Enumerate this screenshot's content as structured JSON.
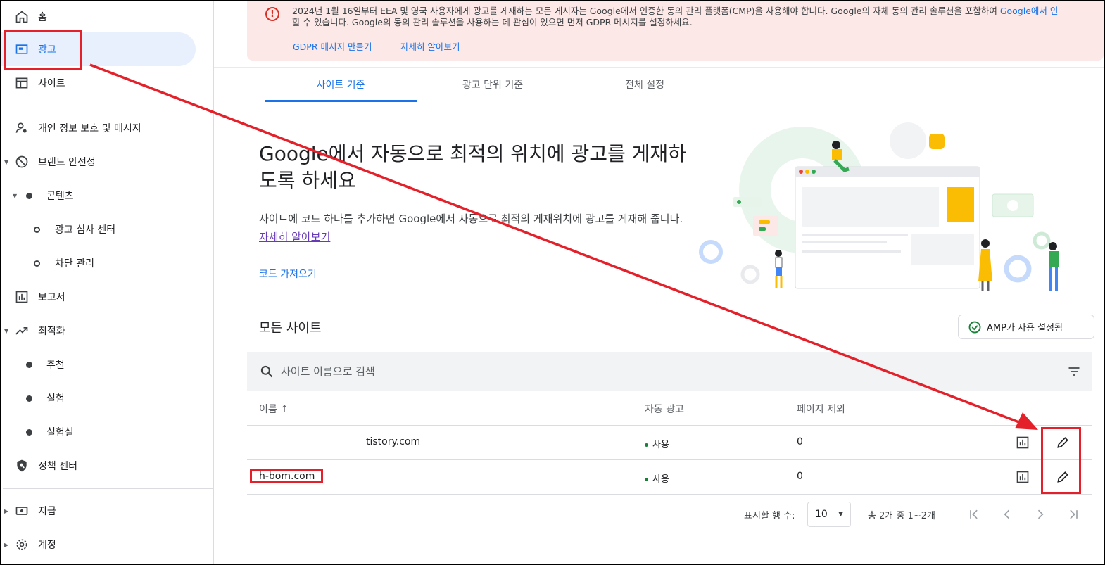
{
  "sidebar": {
    "home": "홈",
    "ads": "광고",
    "sites": "사이트",
    "privacy": "개인 정보 보호 및 메시지",
    "brand_safety": "브랜드 안전성",
    "content": "콘텐츠",
    "ad_review": "광고 심사 센터",
    "blocking": "차단 관리",
    "reports": "보고서",
    "optimization": "최적화",
    "recommendations": "추천",
    "experiments": "실험",
    "lab": "실험실",
    "policy_center": "정책 센터",
    "payments": "지급",
    "account": "계정"
  },
  "banner": {
    "line1_a": "2024년 1월 16일부터 EEA 및 영국 사용자에게 광고를 게재하는 모든 게시자는 Google에서 인증한 동의 관리 플랫폼(CMP)을 사용해야 합니다. Google의 자체 동의 관리 솔루션을 포함하여 ",
    "line1_link": "Google에서 인",
    "line2": "할 수 있습니다. Google의 동의 관리 솔루션을 사용하는 데 관심이 있으면 먼저 GDPR 메시지를 설정하세요.",
    "create_gdpr": "GDPR 메시지 만들기",
    "learn_more": "자세히 알아보기"
  },
  "tabs": [
    {
      "label": "사이트 기준"
    },
    {
      "label": "광고 단위 기준"
    },
    {
      "label": "전체 설정"
    }
  ],
  "hero": {
    "title": "Google에서 자동으로 최적의 위치에 광고를 게재하도록 하세요",
    "text": "사이트에 코드 하나를 추가하면 Google에서 자동으로 최적의 게재위치에 광고를 게재해 줍니다. ",
    "link": "자세히 알아보기",
    "code_button": "코드 가져오기"
  },
  "sites": {
    "title": "모든 사이트",
    "amp_button": "AMP가 사용 설정됨",
    "search_placeholder": "사이트 이름으로 검색",
    "columns": {
      "name": "이름",
      "sort": "↑",
      "auto_ads": "자동 광고",
      "excluded_pages": "페이지 제외"
    },
    "rows": [
      {
        "name": "tistory.com",
        "auto_ads": "사용",
        "excluded": "0"
      },
      {
        "name": "h-bom.com",
        "auto_ads": "사용",
        "excluded": "0"
      }
    ]
  },
  "pagination": {
    "rows_label": "표시할 행 수:",
    "rows_value": "10",
    "range": "총 2개 중 1~2개"
  },
  "colors": {
    "accent": "#1a73e8",
    "annotation": "#e4212a",
    "banner_bg": "#fce8e6",
    "status_dot": "#188038"
  }
}
